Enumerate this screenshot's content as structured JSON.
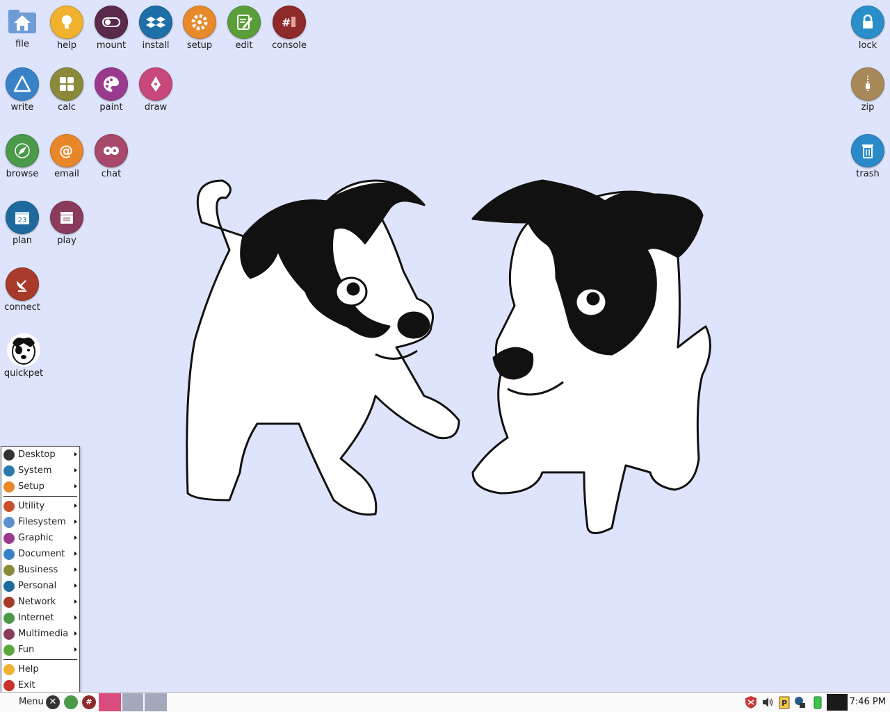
{
  "desktop_icons": {
    "file": {
      "label": "file",
      "icon": "home-folder-icon",
      "color": "#5a8fd0"
    },
    "help": {
      "label": "help",
      "icon": "lightbulb-icon",
      "color": "#f0b22e"
    },
    "mount": {
      "label": "mount",
      "icon": "toggle-switch-icon",
      "color": "#5b2a4a"
    },
    "install": {
      "label": "install",
      "icon": "dropbox-box-icon",
      "color": "#1e6fa8"
    },
    "setup": {
      "label": "setup",
      "icon": "gear-icon",
      "color": "#e8892a"
    },
    "edit": {
      "label": "edit",
      "icon": "notepad-pen-icon",
      "color": "#5a9e3a"
    },
    "console": {
      "label": "console",
      "icon": "terminal-hash-icon",
      "color": "#8e2a2a"
    },
    "lock": {
      "label": "lock",
      "icon": "padlock-icon",
      "color": "#2a8fc8"
    },
    "write": {
      "label": "write",
      "icon": "document-a-icon",
      "color": "#3a82c8"
    },
    "calc": {
      "label": "calc",
      "icon": "calculator-icon",
      "color": "#8a8a3a"
    },
    "paint": {
      "label": "paint",
      "icon": "palette-icon",
      "color": "#9a3a8e"
    },
    "draw": {
      "label": "draw",
      "icon": "draw-pen-icon",
      "color": "#c8487a"
    },
    "zip": {
      "label": "zip",
      "icon": "zipper-icon",
      "color": "#a88a5a"
    },
    "browse": {
      "label": "browse",
      "icon": "compass-icon",
      "color": "#4a9a4a"
    },
    "email": {
      "label": "email",
      "icon": "at-sign-icon",
      "color": "#e8872a"
    },
    "chat": {
      "label": "chat",
      "icon": "chat-bubbles-icon",
      "color": "#a8486a"
    },
    "trash": {
      "label": "trash",
      "icon": "trash-can-icon",
      "color": "#2a8ac8"
    },
    "plan": {
      "label": "plan",
      "icon": "calendar-icon",
      "color": "#1e6a9e",
      "calendar_day": "23"
    },
    "play": {
      "label": "play",
      "icon": "clapperboard-icon",
      "color": "#8a3a5a"
    },
    "connect": {
      "label": "connect",
      "icon": "satellite-dish-icon",
      "color": "#a83a2a"
    },
    "quickpet": {
      "label": "quickpet",
      "icon": "puppy-face-icon",
      "color": "#ffffff"
    }
  },
  "menu": {
    "items_top": [
      {
        "label": "Desktop",
        "icon": "x-logo-icon",
        "color": "#333333"
      },
      {
        "label": "System",
        "icon": "monitor-icon",
        "color": "#2a7ab0"
      },
      {
        "label": "Setup",
        "icon": "gear-icon",
        "color": "#e8892a"
      }
    ],
    "items_mid": [
      {
        "label": "Utility",
        "icon": "utility-icon",
        "color": "#c8502a"
      },
      {
        "label": "Filesystem",
        "icon": "folder-icon",
        "color": "#5a8fd0"
      },
      {
        "label": "Graphic",
        "icon": "palette-icon",
        "color": "#9a3a8e"
      },
      {
        "label": "Document",
        "icon": "document-a-icon",
        "color": "#3a82c8"
      },
      {
        "label": "Business",
        "icon": "calculator-icon",
        "color": "#8a8a3a"
      },
      {
        "label": "Personal",
        "icon": "calendar-icon",
        "color": "#1e6a9e"
      },
      {
        "label": "Network",
        "icon": "satellite-dish-icon",
        "color": "#a83a2a"
      },
      {
        "label": "Internet",
        "icon": "compass-icon",
        "color": "#4a9a4a"
      },
      {
        "label": "Multimedia",
        "icon": "clapperboard-icon",
        "color": "#8a3a5a"
      },
      {
        "label": "Fun",
        "icon": "pacman-icon",
        "color": "#5aa83a"
      }
    ],
    "items_bottom": [
      {
        "label": "Help",
        "icon": "lightbulb-icon",
        "color": "#f0b22e"
      },
      {
        "label": "Exit",
        "icon": "power-icon",
        "color": "#c8302a"
      }
    ]
  },
  "taskbar": {
    "menu_label": "Menu",
    "clock": "7:46 PM",
    "quicklaunch": [
      "x-logo-icon",
      "compass-icon",
      "terminal-hash-icon"
    ],
    "tray": [
      "shield-icon",
      "volume-icon",
      "clipboard-p-icon",
      "network-icon",
      "battery-icon",
      "desktop-preview-icon"
    ],
    "pager_colors": [
      "#d94c7e",
      "#a4a8bc",
      "#a4a8bc"
    ]
  },
  "colors": {
    "desktop_bg": "#dde4fb"
  }
}
